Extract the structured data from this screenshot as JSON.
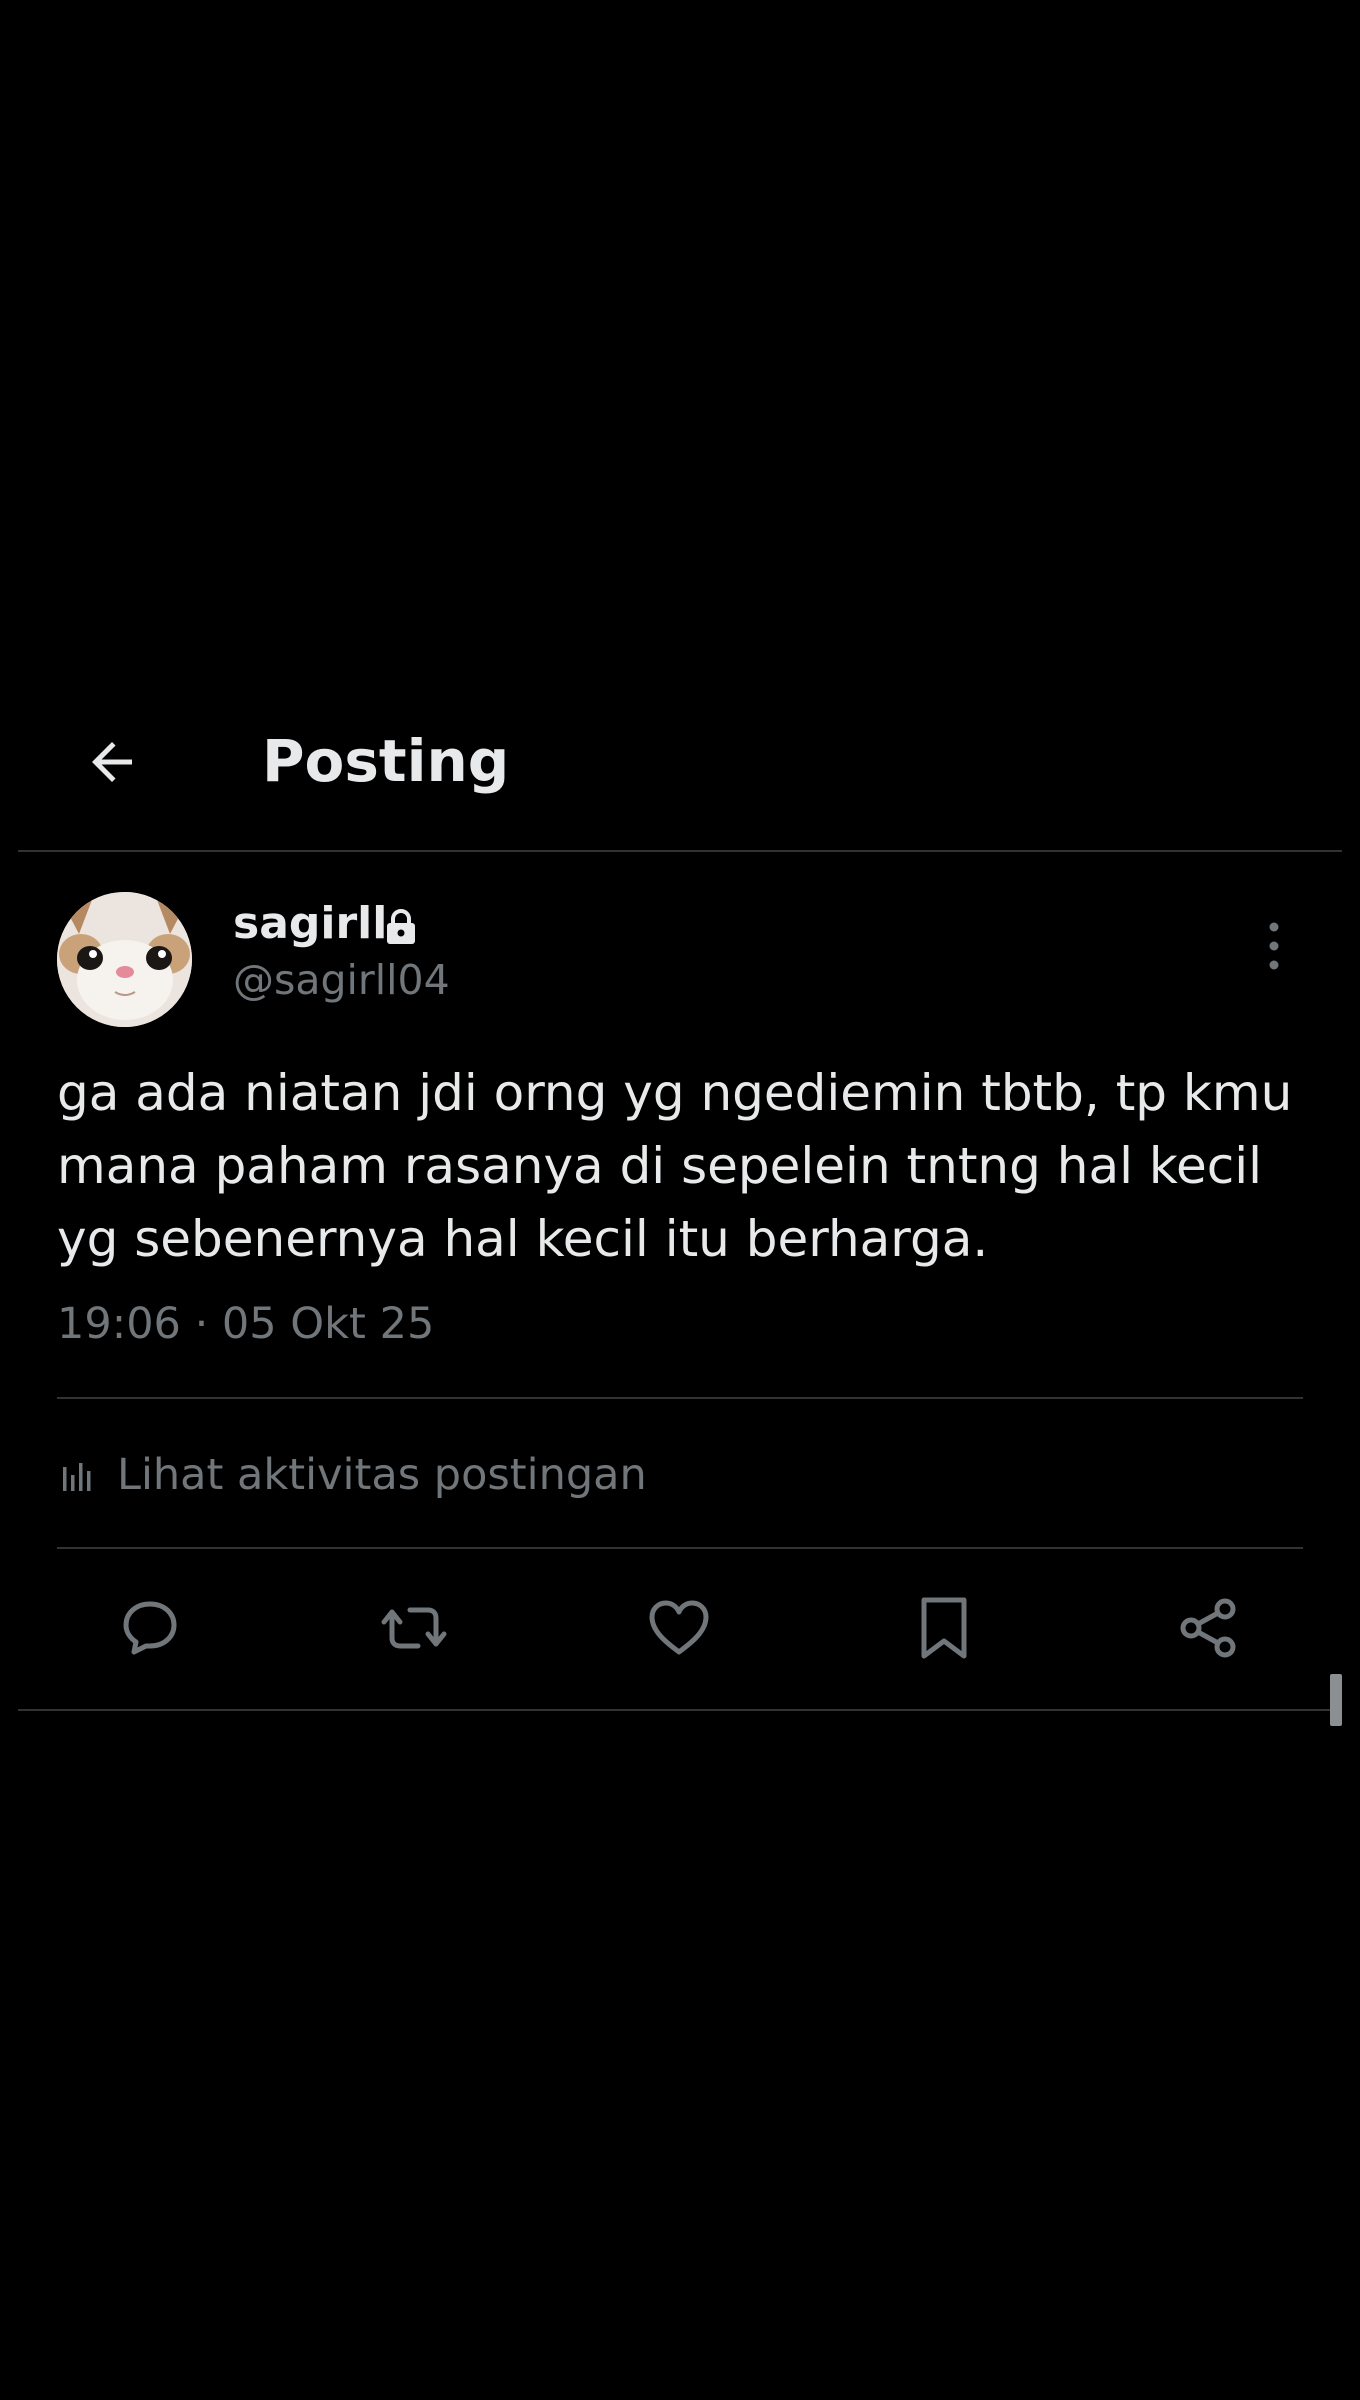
{
  "header": {
    "title": "Posting",
    "back_icon": "arrow-left-icon"
  },
  "post": {
    "author": {
      "display_name": "sagirll",
      "handle": "@sagirll04",
      "protected_icon": "lock-icon",
      "avatar": "cat-face-avatar"
    },
    "text": "ga ada niatan jdi orng yg ngediemin tbtb, tp kmu mana paham rasanya di sepelein tntng hal kecil yg sebenernya hal kecil itu berharga.",
    "timestamp": "19:06 · 05 Okt 25",
    "activity_label": "Lihat aktivitas postingan",
    "actions": [
      "reply-icon",
      "repost-icon",
      "like-icon",
      "bookmark-icon",
      "share-icon"
    ]
  },
  "colors": {
    "background": "#000000",
    "text_primary": "#e7e9ea",
    "text_secondary": "#71767b",
    "divider": "#2f3336"
  }
}
